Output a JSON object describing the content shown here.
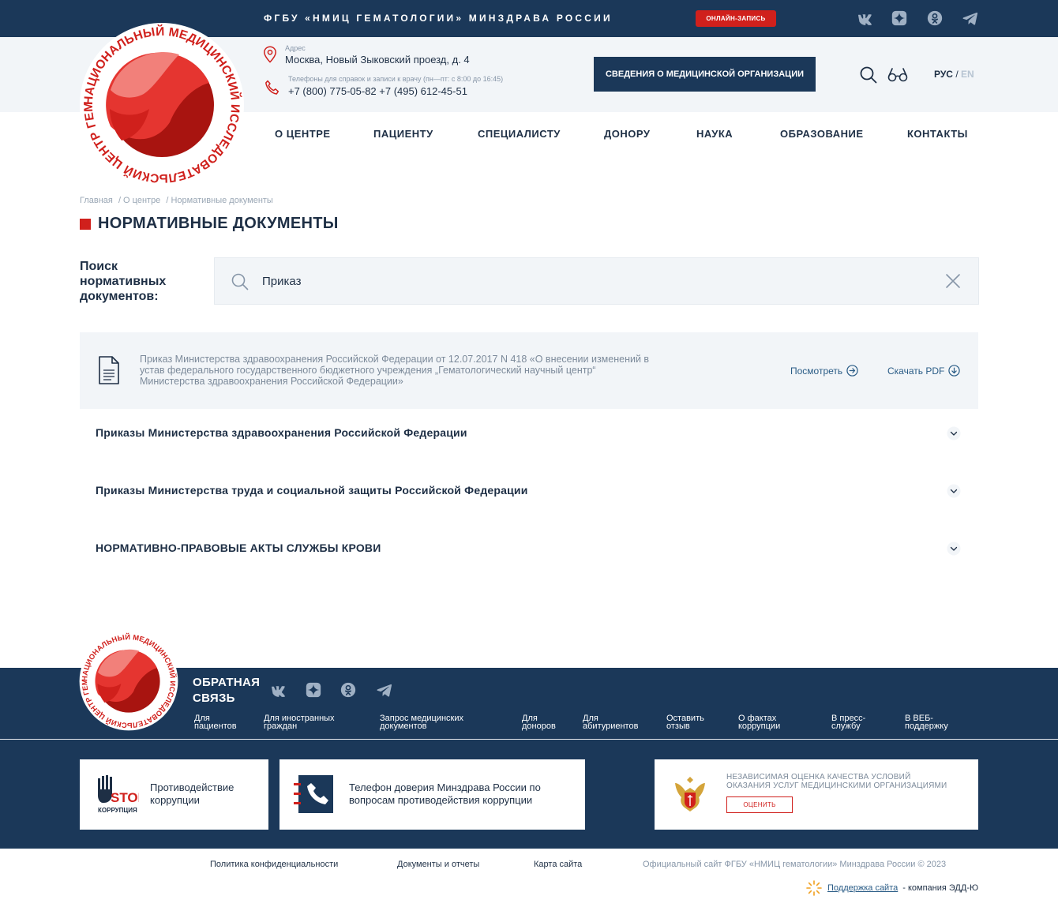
{
  "topbar": {
    "org_name": "ФГБУ «НМИЦ ГЕМАТОЛОГИИ» МИНЗДРАВА РОССИИ",
    "online_button": "ОНЛАЙН-ЗАПИСЬ"
  },
  "logo": {
    "text": "НАЦИОНАЛЬНЫЙ МЕДИЦИНСКИЙ ИССЛЕДОВАТЕЛЬСКИЙ ЦЕНТР ГЕМАТОЛОГИИ"
  },
  "header": {
    "address_label": "Адрес",
    "address_value": "Москва, Новый Зыковский проезд, д. 4",
    "phone_label": "Телефоны для справок и записи к врачу (пн—пт: с 8:00 до 16:45)",
    "phone_value": "+7 (800) 775-05-82 +7 (495) 612-45-51",
    "org_info_button": "СВЕДЕНИЯ О МЕДИЦИНСКОЙ ОРГАНИЗАЦИИ",
    "lang_ru": "РУС",
    "lang_sep": "/",
    "lang_en": "EN"
  },
  "nav": [
    "О ЦЕНТРЕ",
    "ПАЦИЕНТУ",
    "СПЕЦИАЛИСТУ",
    "ДОНОРУ",
    "НАУКА",
    "ОБРАЗОВАНИЕ",
    "КОНТАКТЫ"
  ],
  "breadcrumb": [
    "Главная",
    "/ О центре",
    "/ Нормативные документы"
  ],
  "page_title": "НОРМАТИВНЫЕ ДОКУМЕНТЫ",
  "search": {
    "label": "Поиск нормативных документов:",
    "value": "Приказ"
  },
  "result": {
    "text": "Приказ Министерства здравоохранения Российской Федерации от 12.07.2017 N 418 «О внесении изменений в устав федерального государственного бюджетного учреждения „Гематологический научный центр“ Министерства здравоохранения Российской Федерации»",
    "view": "Посмотреть",
    "download": "Скачать PDF"
  },
  "accordions": [
    "Приказы Министерства здравоохранения Российской Федерации",
    "Приказы Министерства труда и социальной защиты Российской Федерации",
    "НОРМАТИВНО-ПРАВОВЫЕ АКТЫ СЛУЖБЫ КРОВИ"
  ],
  "footer": {
    "feedback_title_1": "ОБРАТНАЯ",
    "feedback_title_2": "СВЯЗЬ",
    "links": [
      [
        "Для",
        "пациентов"
      ],
      [
        "Для иностранных",
        "граждан"
      ],
      [
        "Запрос медицинских",
        "документов"
      ],
      [
        "Для",
        "доноров"
      ],
      [
        "Для",
        "абитуриентов"
      ],
      [
        "Оставить",
        "отзыв"
      ],
      [
        "О фактах",
        "коррупции"
      ],
      [
        "В пресс-",
        "службу"
      ],
      [
        "В ВЕБ-",
        "поддержку"
      ]
    ],
    "card_anticorruption_1": "Противодействие",
    "card_anticorruption_2": "коррупции",
    "stop_logo_1": "STOP",
    "stop_logo_2": "КОРРУПЦИЯ",
    "card_hotline_1": "Телефон доверия Минздрава России по",
    "card_hotline_2": "вопросам противодействия коррупции",
    "card_rating_1": "НЕЗАВИСИМАЯ ОЦЕНКА КАЧЕСТВА УСЛОВИЙ",
    "card_rating_2": "ОКАЗАНИЯ УСЛУГ МЕДИЦИНСКИМИ ОРГАНИЗАЦИЯМИ",
    "rate_button": "ОЦЕНИТЬ"
  },
  "bottom": {
    "privacy": "Политика конфиденциальности",
    "docs": "Документы и отчеты",
    "sitemap": "Карта сайта",
    "copyright": "Официальный сайт ФГБУ «НМИЦ гематологии» Минздрава России © 2023",
    "support_link": "Поддержка сайта",
    "support_company": "- компания ЭДД-Ю"
  },
  "colors": {
    "navy": "#1b3859",
    "accent_red": "#d0201c",
    "light_bg": "#f2f5f8"
  },
  "icons": [
    "vk-icon",
    "dzen-icon",
    "odnoklassniki-icon",
    "telegram-icon",
    "location-icon",
    "phone-icon",
    "search-icon",
    "glasses-icon",
    "close-icon",
    "document-icon",
    "arrow-right-circle-icon",
    "arrow-down-circle-icon",
    "chevron-down-icon"
  ]
}
